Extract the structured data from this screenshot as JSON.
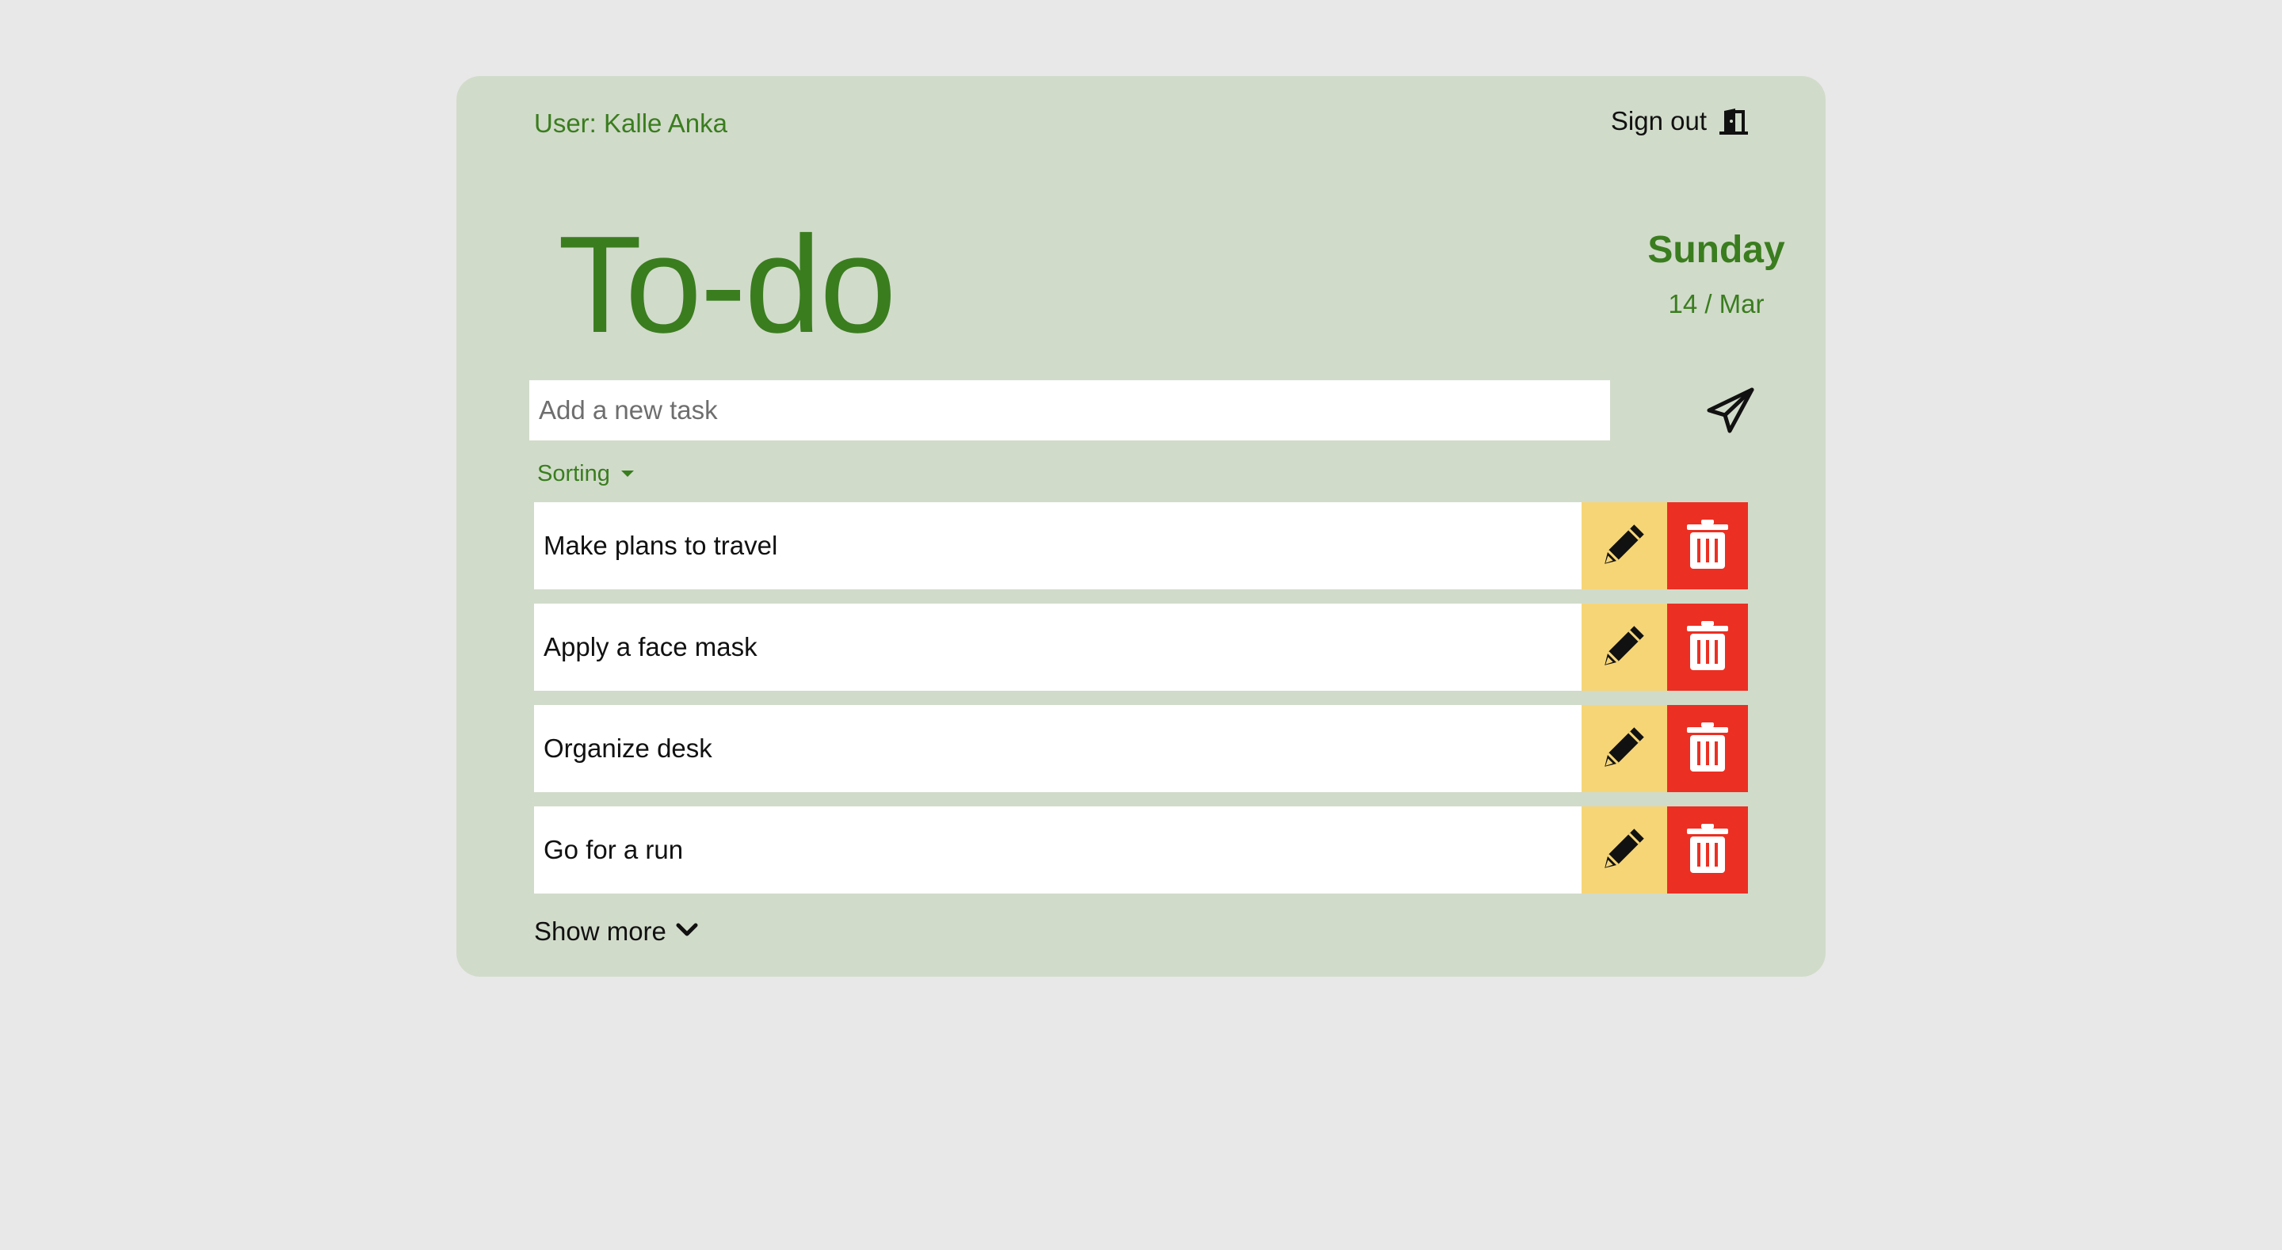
{
  "header": {
    "user_label": "User: Kalle Anka",
    "signout_label": "Sign out",
    "signout_icon": "door-exit-icon"
  },
  "title": "To-do",
  "date": {
    "day": "Sunday",
    "date_text": "14 / Mar"
  },
  "new_task": {
    "value": "",
    "placeholder": "Add a new task",
    "submit_icon": "paper-plane-icon"
  },
  "sorting": {
    "label": "Sorting",
    "icon": "caret-down-icon"
  },
  "tasks": [
    {
      "text": "Make plans to travel"
    },
    {
      "text": "Apply a face mask"
    },
    {
      "text": "Organize desk"
    },
    {
      "text": "Go for a run"
    }
  ],
  "row_icons": {
    "edit": "pencil-icon",
    "delete": "trash-icon"
  },
  "show_more": {
    "label": "Show more",
    "icon": "chevron-down-icon"
  },
  "colors": {
    "page_bg": "#e8e8e8",
    "card_bg": "#d1dbca",
    "accent_green": "#3a7d1f",
    "edit_bg": "#f6d577",
    "delete_bg": "#ec2f23"
  }
}
